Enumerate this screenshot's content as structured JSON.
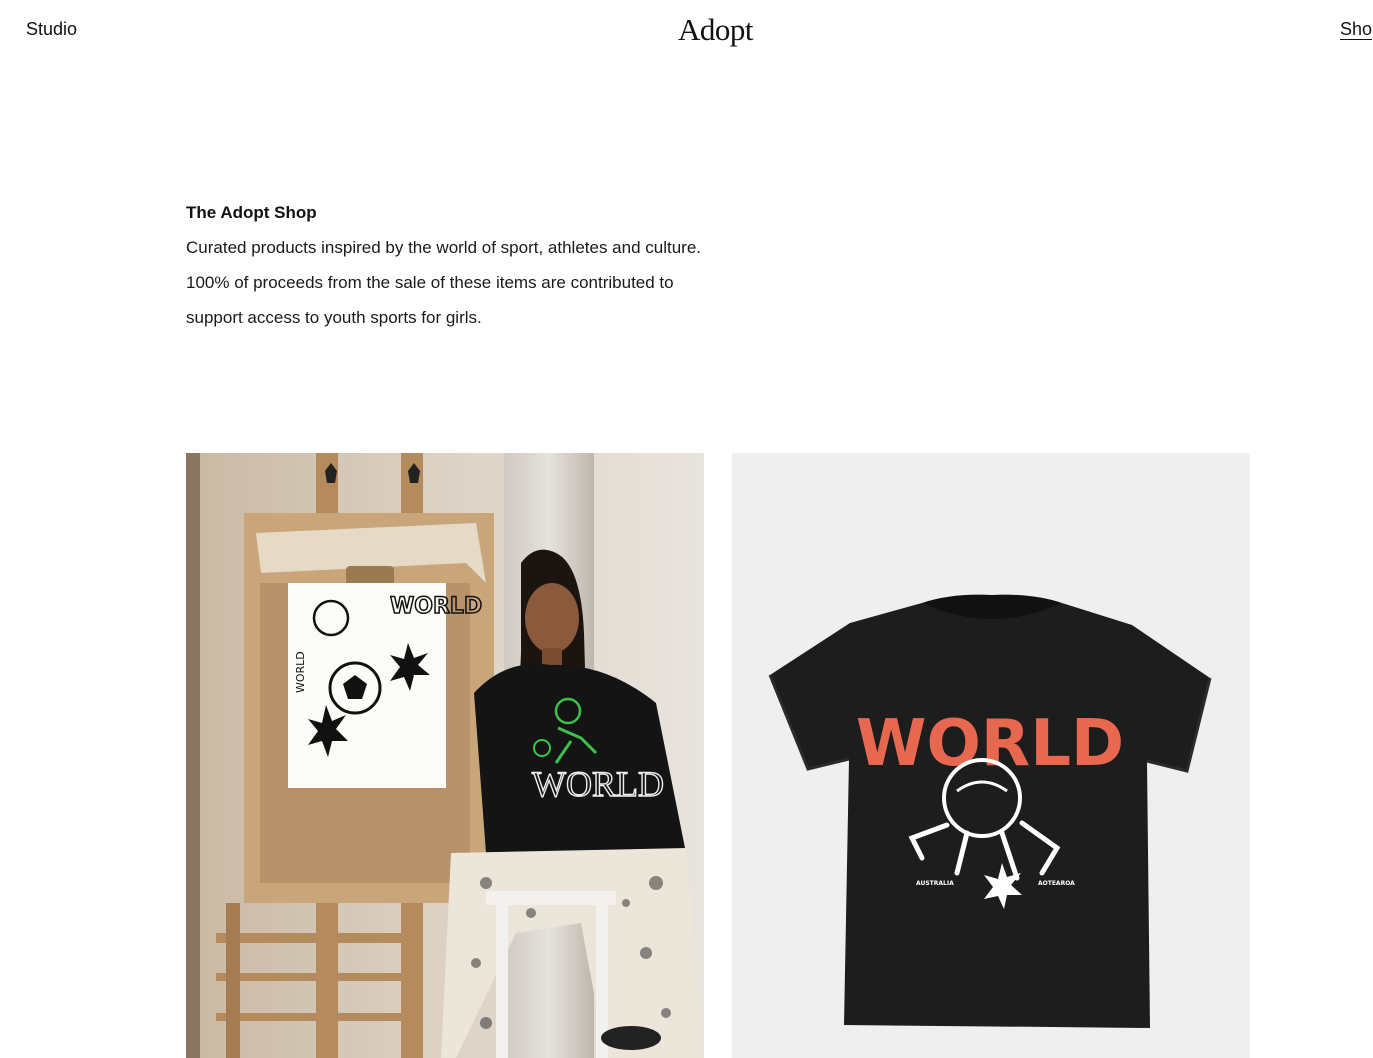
{
  "header": {
    "nav_left": "Studio",
    "logo": "Adopt",
    "nav_right": "Sho"
  },
  "intro": {
    "title": "The Adopt Shop",
    "body": "Curated products inspired by the world of sport, athletes and culture. 100% of proceeds from the sale of these items are contributed to support access to youth sports for girls."
  },
  "products": [
    {
      "image_subject": "woman in WORLD sweatshirt beside easel with soccer drawing",
      "hoodie_text": "WORLD",
      "poster_text": "WORLD"
    },
    {
      "image_subject": "black WORLD t-shirt",
      "tee_text": "WORLD",
      "tee_left_small": "AUSTRALIA",
      "tee_right_small": "AOTEAROA",
      "tee_accent_color": "#e8684f"
    }
  ]
}
